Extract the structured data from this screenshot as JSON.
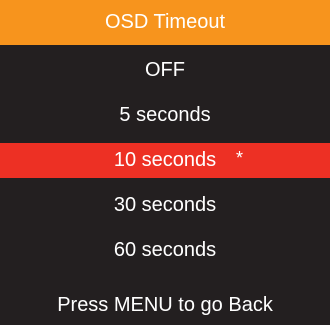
{
  "menu": {
    "title": "OSD Timeout",
    "options": [
      {
        "label": "OFF",
        "selected": false,
        "marker": ""
      },
      {
        "label": "5 seconds",
        "selected": false,
        "marker": ""
      },
      {
        "label": "10 seconds",
        "selected": true,
        "marker": "*"
      },
      {
        "label": "30 seconds",
        "selected": false,
        "marker": ""
      },
      {
        "label": "60 seconds",
        "selected": false,
        "marker": ""
      }
    ],
    "footer": "Press MENU to go Back"
  },
  "colors": {
    "background": "#231f20",
    "title_bar": "#f7941d",
    "selected_row": "#ed3024",
    "text": "#ffffff"
  }
}
